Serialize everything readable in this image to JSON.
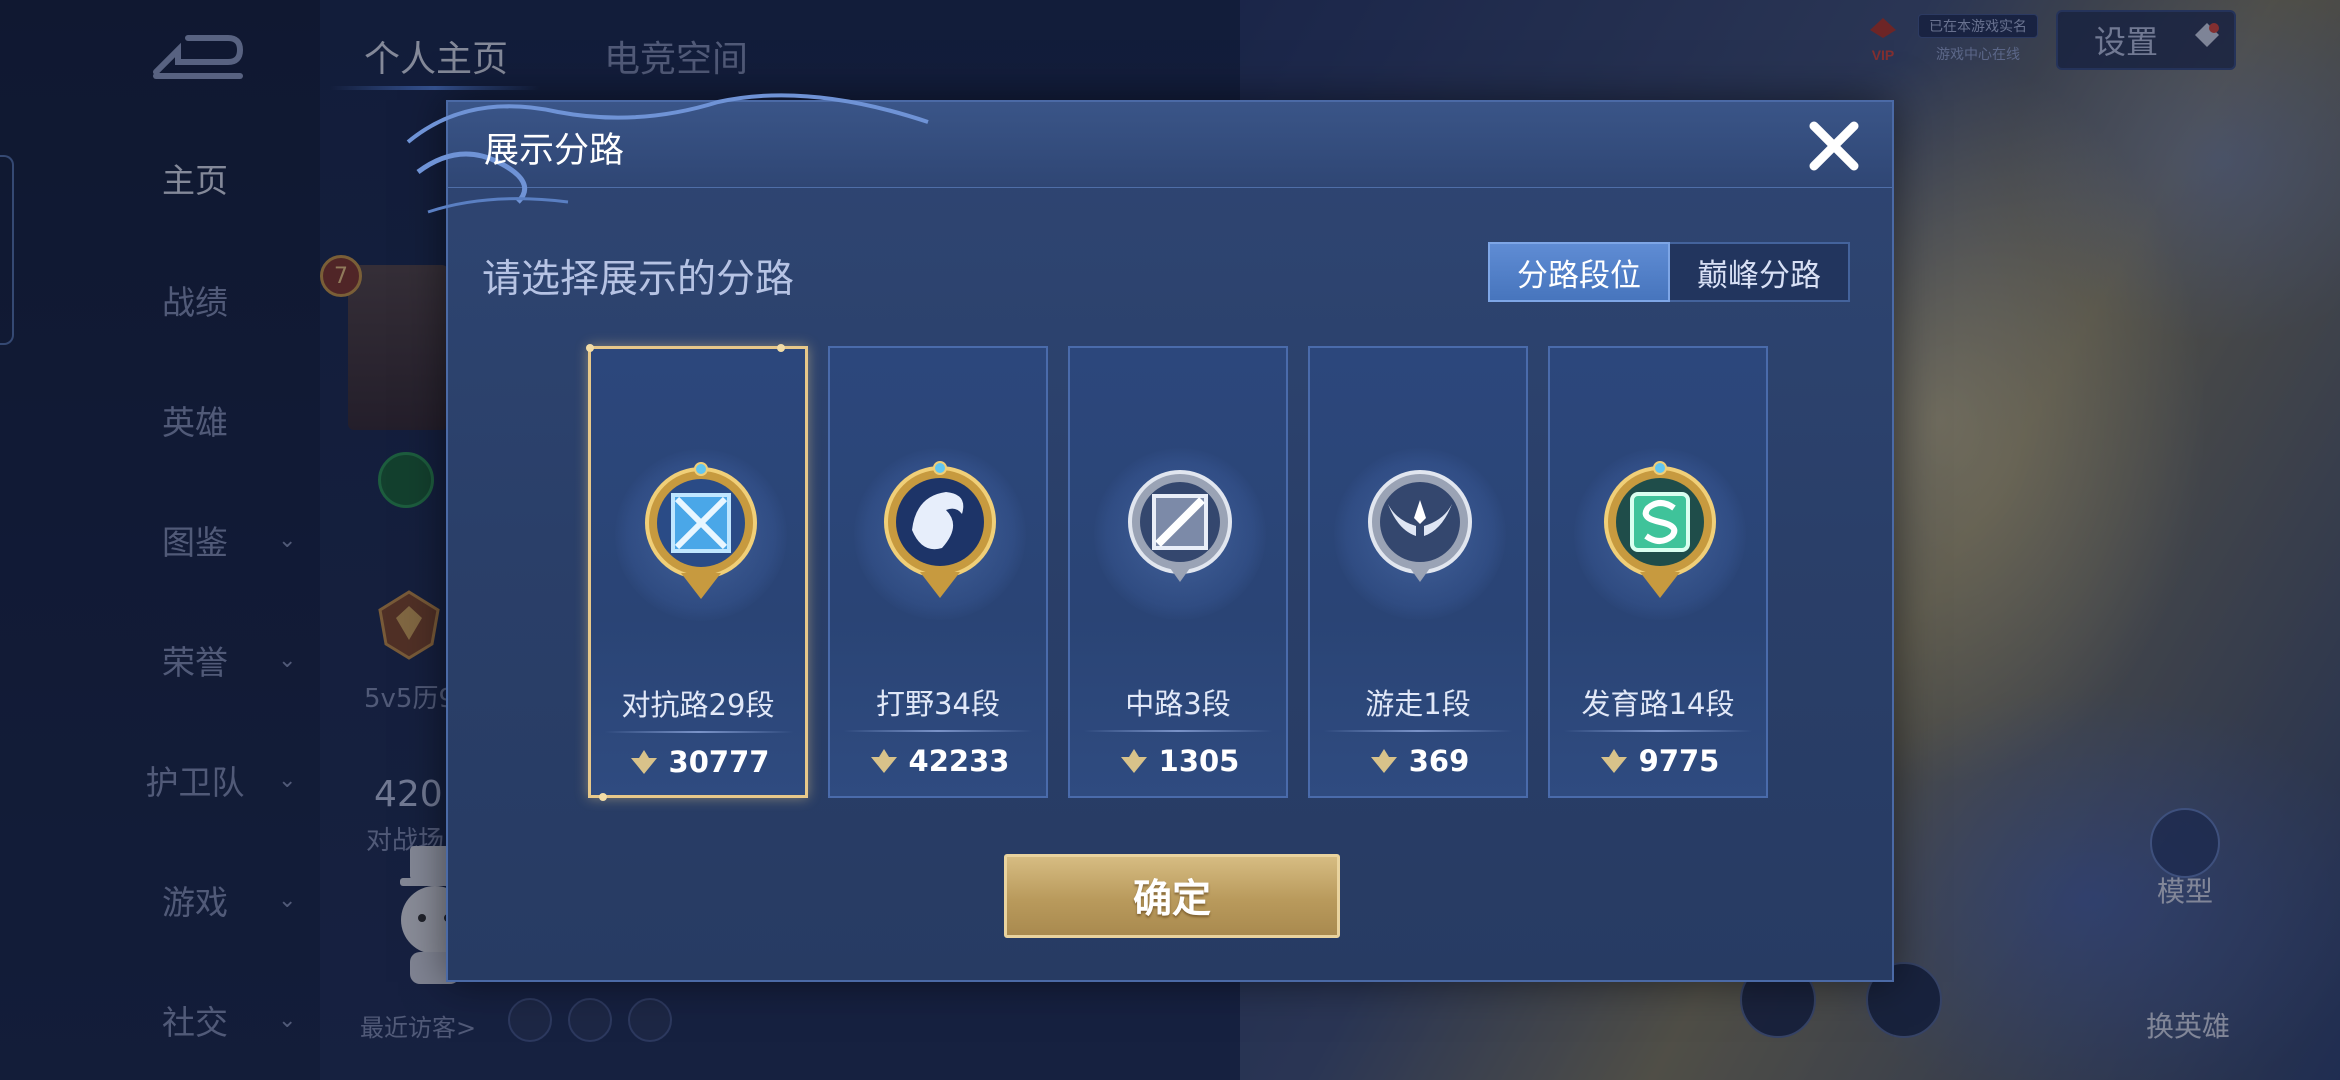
{
  "nav": {
    "items": [
      {
        "label": "主页",
        "has_chevron": false
      },
      {
        "label": "战绩",
        "has_chevron": false
      },
      {
        "label": "英雄",
        "has_chevron": false
      },
      {
        "label": "图鉴",
        "has_chevron": true
      },
      {
        "label": "荣誉",
        "has_chevron": true
      },
      {
        "label": "护卫队",
        "has_chevron": true
      },
      {
        "label": "游戏",
        "has_chevron": true
      },
      {
        "label": "社交",
        "has_chevron": true
      }
    ]
  },
  "top_tabs": [
    "个人主页",
    "电竞空间"
  ],
  "header_right": {
    "vip_label": "VIP",
    "badge_text": "已在本游戏实名",
    "badge_sub": "游戏中心在线",
    "settings_label": "设置"
  },
  "profile_peek": {
    "level": "7",
    "mode_text": "5v5历9",
    "count": "420",
    "count_label": "对战场",
    "visitors_label": "最近访客>"
  },
  "bottom_right": {
    "model_label": "模型",
    "swap_label": "换英雄"
  },
  "modal": {
    "title": "展示分路",
    "subtitle": "请选择展示的分路",
    "segments": [
      {
        "label": "分路段位",
        "active": true
      },
      {
        "label": "巅峰分路",
        "active": false
      }
    ],
    "cards": [
      {
        "name": "对抗路29段",
        "score": "30777",
        "selected": true,
        "emblem": "clash-lane-emblem-icon"
      },
      {
        "name": "打野34段",
        "score": "42233",
        "selected": false,
        "emblem": "jungle-dragon-emblem-icon"
      },
      {
        "name": "中路3段",
        "score": "1305",
        "selected": false,
        "emblem": "mid-lane-emblem-icon"
      },
      {
        "name": "游走1段",
        "score": "369",
        "selected": false,
        "emblem": "roam-wings-emblem-icon"
      },
      {
        "name": "发育路14段",
        "score": "9775",
        "selected": false,
        "emblem": "farm-lane-emblem-icon"
      }
    ],
    "confirm_label": "确定"
  },
  "colors": {
    "modal_bg": "#2c4270",
    "accent_blue": "#4775bd",
    "gold": "#d6bc82",
    "selected_border": "#e7c88a"
  }
}
